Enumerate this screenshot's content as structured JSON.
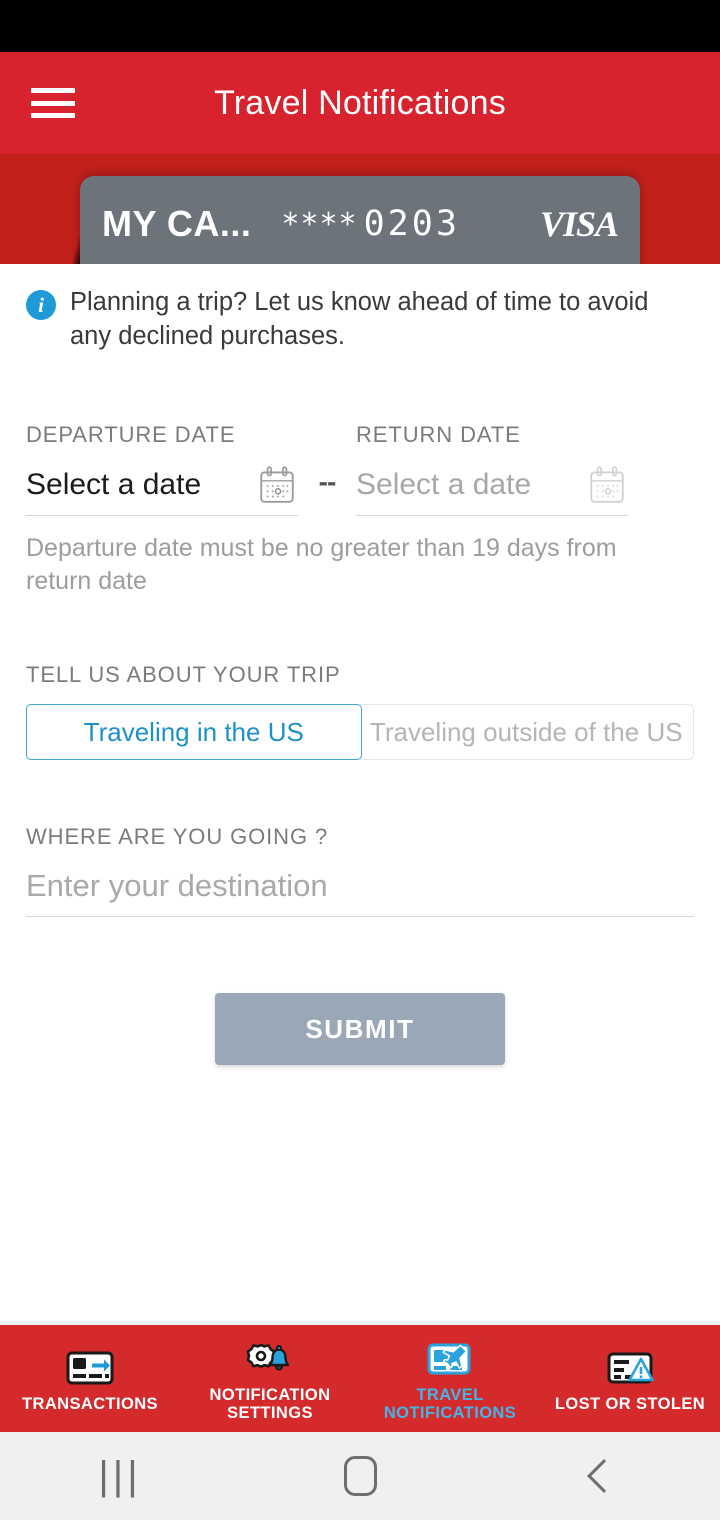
{
  "header": {
    "title": "Travel Notifications",
    "menu_icon": "hamburger-menu-icon",
    "background_color": "#d8232f"
  },
  "card": {
    "nickname": "MY CA...",
    "mask": "****",
    "last_four": "0203",
    "brand": "VISA",
    "background_color": "#6c737b"
  },
  "info_banner": {
    "icon": "info-circle-icon",
    "text": "Planning a trip? Let us know ahead of time to avoid any declined purchases.",
    "icon_color": "#1e9ad6"
  },
  "departure": {
    "label": "DEPARTURE DATE",
    "value": "Select a date",
    "icon": "calendar-icon"
  },
  "separator": "--",
  "return": {
    "label": "RETURN DATE",
    "placeholder": "Select a date",
    "icon": "calendar-icon"
  },
  "date_hint": "Departure date must be no greater than 19 days from return date",
  "trip": {
    "label": "TELL US ABOUT YOUR TRIP",
    "options": [
      {
        "label": "Traveling in the US",
        "selected": true
      },
      {
        "label": "Traveling outside of the US",
        "selected": false
      }
    ],
    "active_color": "#1e91c7"
  },
  "destination": {
    "label": "WHERE ARE YOU GOING ?",
    "placeholder": "Enter your destination",
    "value": ""
  },
  "submit": {
    "label": "SUBMIT",
    "background_color": "#9aa7b7"
  },
  "tab_bar": {
    "background_color": "#d42a2c",
    "active_color": "#41b6e6",
    "items": [
      {
        "label": "TRANSACTIONS",
        "icon": "card-arrow-icon",
        "active": false
      },
      {
        "label": "NOTIFICATION SETTINGS",
        "icon": "gear-bell-icon",
        "active": false
      },
      {
        "label": "TRAVEL NOTIFICATIONS",
        "icon": "card-airplane-icon",
        "active": true
      },
      {
        "label": "LOST OR STOLEN",
        "icon": "card-warning-icon",
        "active": false
      }
    ]
  },
  "android_nav": {
    "recents_icon": "recents-icon",
    "home_icon": "home-icon",
    "back_icon": "back-icon",
    "recents_glyph": "|||"
  }
}
